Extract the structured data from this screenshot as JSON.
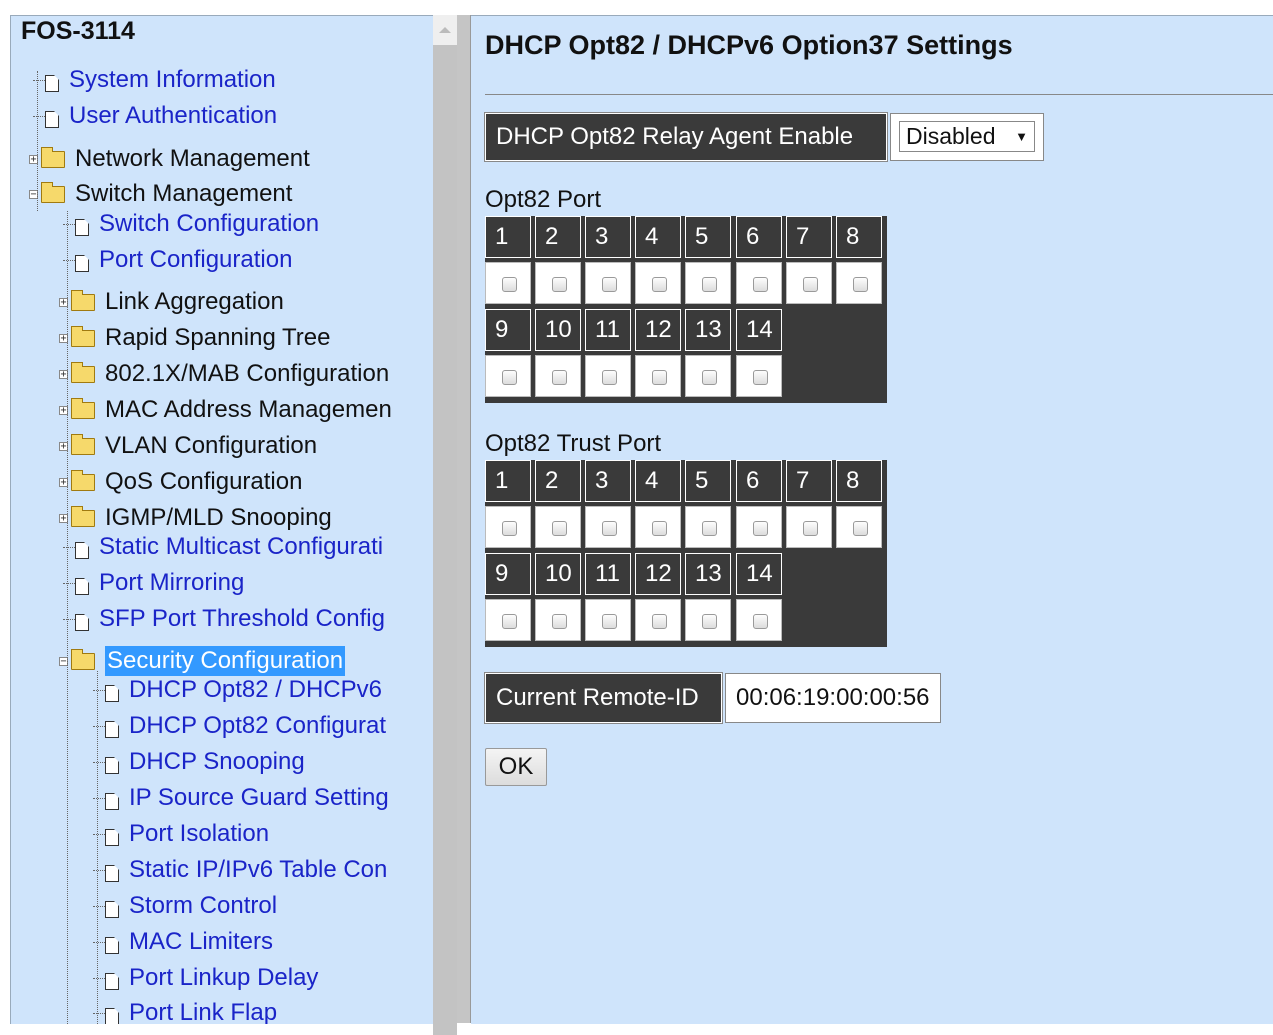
{
  "sidebar": {
    "system_name": "FOS-3114",
    "items": [
      {
        "label": "System Information",
        "kind": "doc",
        "level": 0,
        "link": true
      },
      {
        "label": "User Authentication",
        "kind": "doc",
        "level": 0,
        "link": true
      },
      {
        "label": "Network Management",
        "kind": "folder",
        "level": 0,
        "expanded": false
      },
      {
        "label": "Switch Management",
        "kind": "folder",
        "level": 0,
        "expanded": true
      },
      {
        "label": "Switch Configuration",
        "kind": "doc",
        "level": 1,
        "link": true
      },
      {
        "label": "Port Configuration",
        "kind": "doc",
        "level": 1,
        "link": true
      },
      {
        "label": "Link Aggregation",
        "kind": "folder",
        "level": 1,
        "expanded": false
      },
      {
        "label": "Rapid Spanning Tree",
        "kind": "folder",
        "level": 1,
        "expanded": false
      },
      {
        "label": "802.1X/MAB Configuration",
        "kind": "folder",
        "level": 1,
        "expanded": false
      },
      {
        "label": "MAC Address Managemen",
        "kind": "folder",
        "level": 1,
        "expanded": false
      },
      {
        "label": "VLAN Configuration",
        "kind": "folder",
        "level": 1,
        "expanded": false
      },
      {
        "label": "QoS Configuration",
        "kind": "folder",
        "level": 1,
        "expanded": false
      },
      {
        "label": "IGMP/MLD Snooping",
        "kind": "folder",
        "level": 1,
        "expanded": false
      },
      {
        "label": "Static Multicast Configurati",
        "kind": "doc",
        "level": 1,
        "link": true
      },
      {
        "label": "Port Mirroring",
        "kind": "doc",
        "level": 1,
        "link": true
      },
      {
        "label": "SFP Port Threshold Config",
        "kind": "doc",
        "level": 1,
        "link": true
      },
      {
        "label": "Security Configuration",
        "kind": "folder",
        "level": 1,
        "expanded": true,
        "selected": true
      },
      {
        "label": "DHCP Opt82 / DHCPv6",
        "kind": "doc",
        "level": 2,
        "link": true
      },
      {
        "label": "DHCP Opt82 Configurat",
        "kind": "doc",
        "level": 2,
        "link": true
      },
      {
        "label": "DHCP Snooping",
        "kind": "doc",
        "level": 2,
        "link": true
      },
      {
        "label": "IP Source Guard Setting",
        "kind": "doc",
        "level": 2,
        "link": true
      },
      {
        "label": "Port Isolation",
        "kind": "doc",
        "level": 2,
        "link": true
      },
      {
        "label": "Static IP/IPv6 Table Con",
        "kind": "doc",
        "level": 2,
        "link": true
      },
      {
        "label": "Storm Control",
        "kind": "doc",
        "level": 2,
        "link": true
      },
      {
        "label": "MAC Limiters",
        "kind": "doc",
        "level": 2,
        "link": true
      },
      {
        "label": "Port Linkup Delay",
        "kind": "doc",
        "level": 2,
        "link": true
      },
      {
        "label": "Port Link Flap",
        "kind": "doc",
        "level": 2,
        "link": true
      }
    ]
  },
  "main": {
    "title": "DHCP Opt82 / DHCPv6 Option37 Settings",
    "relay": {
      "label": "DHCP Opt82 Relay Agent Enable",
      "value": "Disabled"
    },
    "opt82_port": {
      "label": "Opt82 Port",
      "ports": [
        "1",
        "2",
        "3",
        "4",
        "5",
        "6",
        "7",
        "8",
        "9",
        "10",
        "11",
        "12",
        "13",
        "14"
      ]
    },
    "trust_port": {
      "label": "Opt82 Trust Port",
      "ports": [
        "1",
        "2",
        "3",
        "4",
        "5",
        "6",
        "7",
        "8",
        "9",
        "10",
        "11",
        "12",
        "13",
        "14"
      ]
    },
    "remote_id": {
      "label": "Current Remote-ID",
      "value": "00:06:19:00:00:56"
    },
    "ok_label": "OK"
  }
}
